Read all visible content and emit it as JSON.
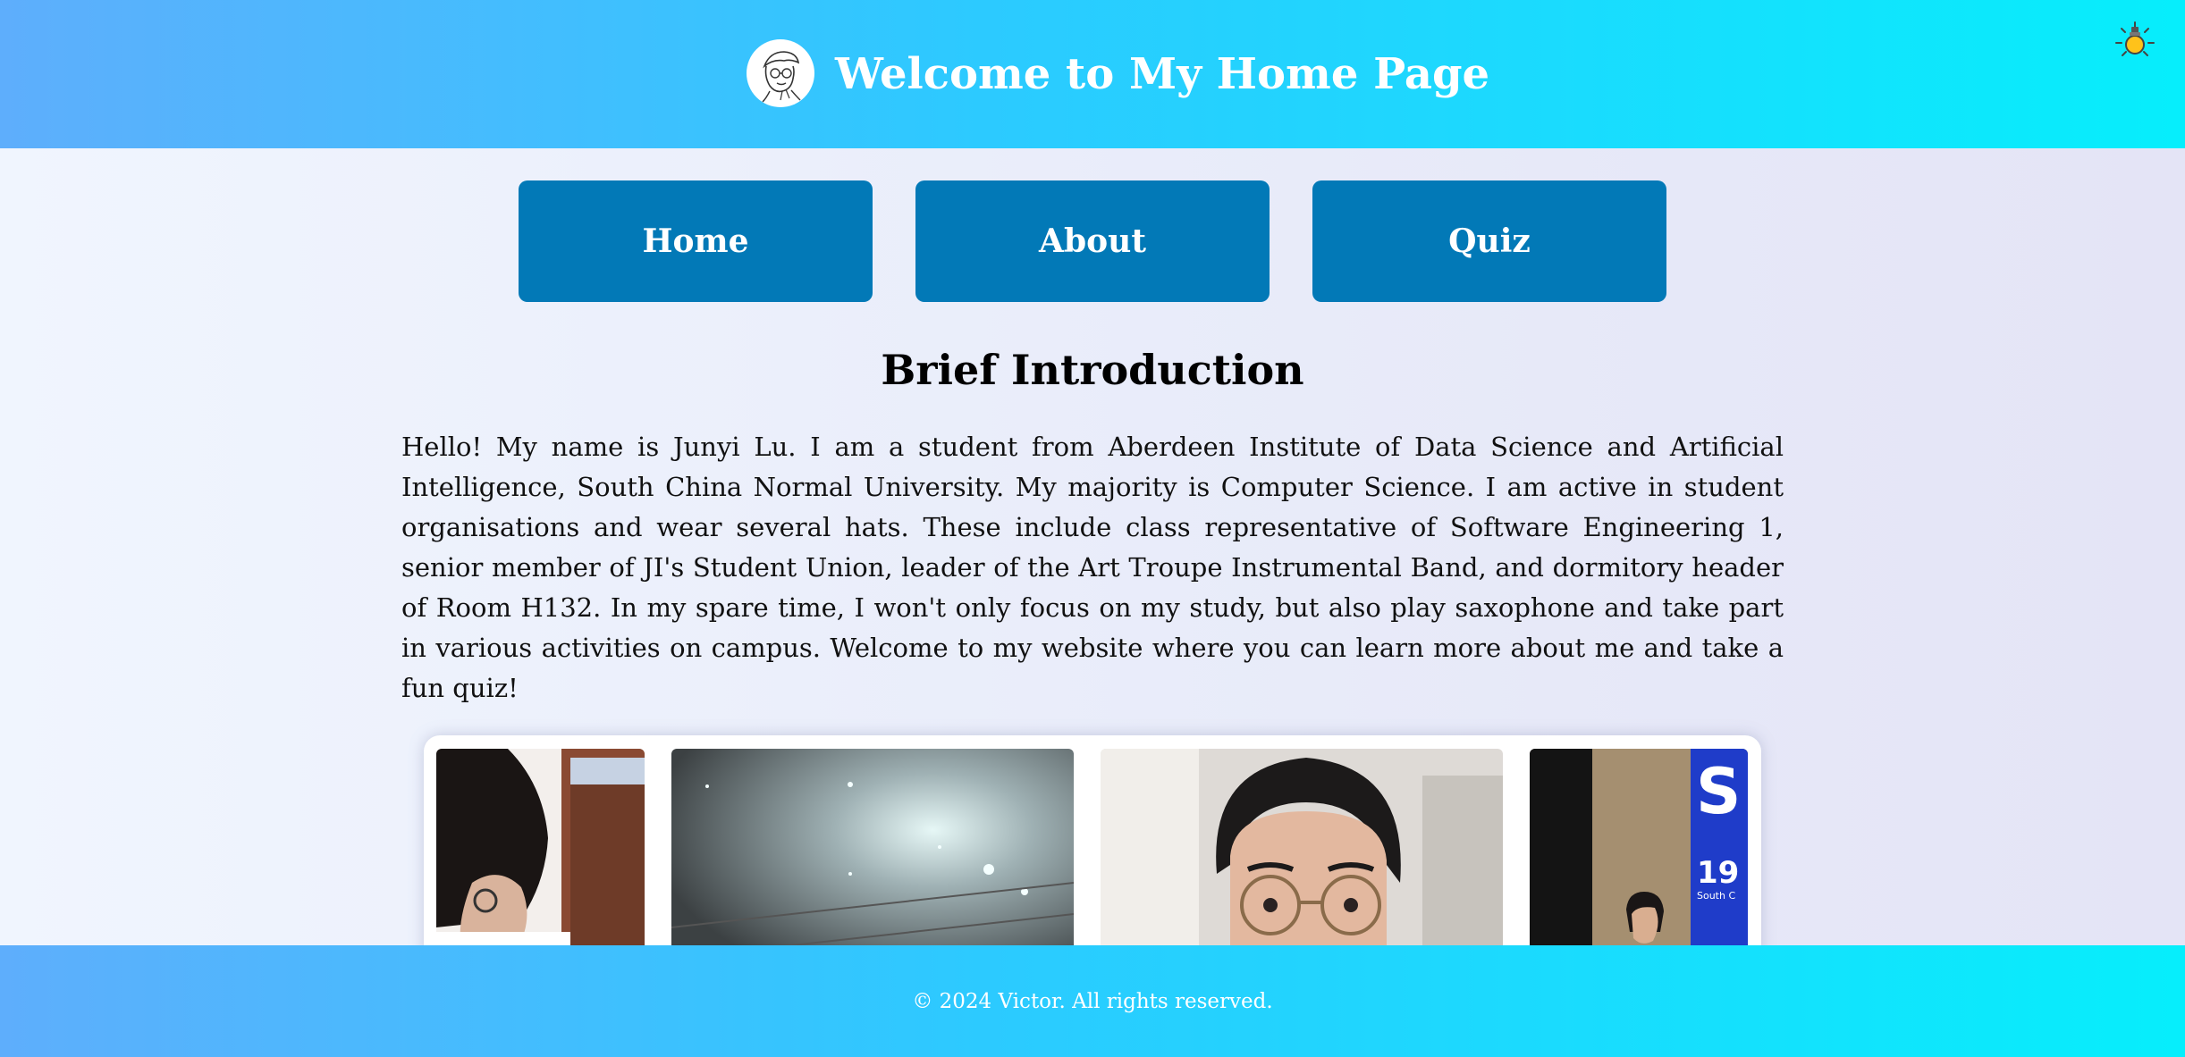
{
  "header": {
    "title": "Welcome to My Home Page",
    "logo_icon": "sketch-portrait-avatar",
    "theme_toggle_icon": "lightbulb-icon"
  },
  "nav": {
    "items": [
      {
        "label": "Home"
      },
      {
        "label": "About"
      },
      {
        "label": "Quiz"
      }
    ]
  },
  "main": {
    "heading": "Brief Introduction",
    "intro": "Hello! My name is Junyi Lu. I am a student from Aberdeen Institute of Data Science and Artificial Intelligence, South China Normal University. My majority is Computer Science. I am active in student organisations and wear several hats. These include class representative of Software Engineering 1, senior member of JI's Student Union, leader of the Art Troupe Instrumental Band, and dormitory header of Room H132. In my spare time, I won't only focus on my study, but also play saxophone and take part in various activities on campus. Welcome to my website where you can learn more about me and take a fun quiz!"
  },
  "gallery": {
    "photos": [
      {
        "subject": "student-at-desk"
      },
      {
        "subject": "auditorium-ceiling-lights"
      },
      {
        "subject": "portrait-with-glasses"
      },
      {
        "subject": "speaker-at-stage",
        "banner_text": "S",
        "banner_number": "19",
        "banner_small": "South C"
      }
    ]
  },
  "footer": {
    "text": "© 2024 Victor. All rights reserved."
  },
  "colors": {
    "header_gradient_start": "#5eaefc",
    "header_gradient_end": "#06eefc",
    "nav_button": "#0279b7",
    "page_background": "#eceff9"
  }
}
